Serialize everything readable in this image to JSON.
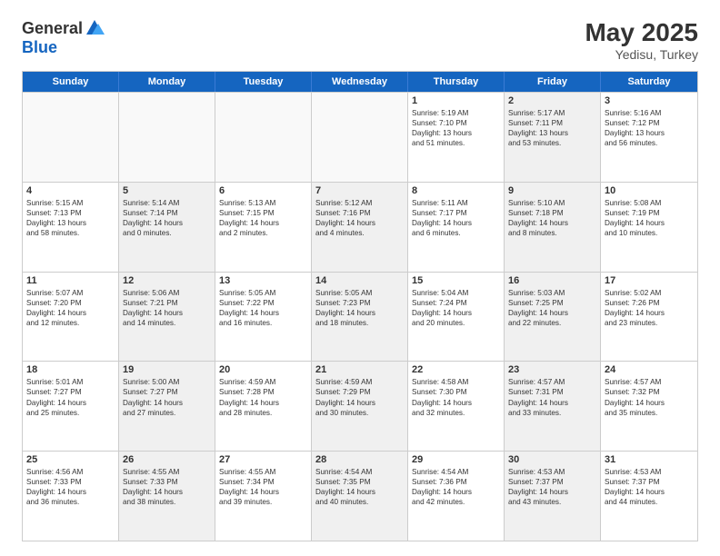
{
  "header": {
    "logo_general": "General",
    "logo_blue": "Blue",
    "month_year": "May 2025",
    "location": "Yedisu, Turkey"
  },
  "days_of_week": [
    "Sunday",
    "Monday",
    "Tuesday",
    "Wednesday",
    "Thursday",
    "Friday",
    "Saturday"
  ],
  "rows": [
    [
      {
        "day": "",
        "info": [],
        "empty": true
      },
      {
        "day": "",
        "info": [],
        "empty": true
      },
      {
        "day": "",
        "info": [],
        "empty": true
      },
      {
        "day": "",
        "info": [],
        "empty": true
      },
      {
        "day": "1",
        "info": [
          "Sunrise: 5:19 AM",
          "Sunset: 7:10 PM",
          "Daylight: 13 hours",
          "and 51 minutes."
        ]
      },
      {
        "day": "2",
        "info": [
          "Sunrise: 5:17 AM",
          "Sunset: 7:11 PM",
          "Daylight: 13 hours",
          "and 53 minutes."
        ],
        "shaded": true
      },
      {
        "day": "3",
        "info": [
          "Sunrise: 5:16 AM",
          "Sunset: 7:12 PM",
          "Daylight: 13 hours",
          "and 56 minutes."
        ]
      }
    ],
    [
      {
        "day": "4",
        "info": [
          "Sunrise: 5:15 AM",
          "Sunset: 7:13 PM",
          "Daylight: 13 hours",
          "and 58 minutes."
        ]
      },
      {
        "day": "5",
        "info": [
          "Sunrise: 5:14 AM",
          "Sunset: 7:14 PM",
          "Daylight: 14 hours",
          "and 0 minutes."
        ],
        "shaded": true
      },
      {
        "day": "6",
        "info": [
          "Sunrise: 5:13 AM",
          "Sunset: 7:15 PM",
          "Daylight: 14 hours",
          "and 2 minutes."
        ]
      },
      {
        "day": "7",
        "info": [
          "Sunrise: 5:12 AM",
          "Sunset: 7:16 PM",
          "Daylight: 14 hours",
          "and 4 minutes."
        ],
        "shaded": true
      },
      {
        "day": "8",
        "info": [
          "Sunrise: 5:11 AM",
          "Sunset: 7:17 PM",
          "Daylight: 14 hours",
          "and 6 minutes."
        ]
      },
      {
        "day": "9",
        "info": [
          "Sunrise: 5:10 AM",
          "Sunset: 7:18 PM",
          "Daylight: 14 hours",
          "and 8 minutes."
        ],
        "shaded": true
      },
      {
        "day": "10",
        "info": [
          "Sunrise: 5:08 AM",
          "Sunset: 7:19 PM",
          "Daylight: 14 hours",
          "and 10 minutes."
        ]
      }
    ],
    [
      {
        "day": "11",
        "info": [
          "Sunrise: 5:07 AM",
          "Sunset: 7:20 PM",
          "Daylight: 14 hours",
          "and 12 minutes."
        ]
      },
      {
        "day": "12",
        "info": [
          "Sunrise: 5:06 AM",
          "Sunset: 7:21 PM",
          "Daylight: 14 hours",
          "and 14 minutes."
        ],
        "shaded": true
      },
      {
        "day": "13",
        "info": [
          "Sunrise: 5:05 AM",
          "Sunset: 7:22 PM",
          "Daylight: 14 hours",
          "and 16 minutes."
        ]
      },
      {
        "day": "14",
        "info": [
          "Sunrise: 5:05 AM",
          "Sunset: 7:23 PM",
          "Daylight: 14 hours",
          "and 18 minutes."
        ],
        "shaded": true
      },
      {
        "day": "15",
        "info": [
          "Sunrise: 5:04 AM",
          "Sunset: 7:24 PM",
          "Daylight: 14 hours",
          "and 20 minutes."
        ]
      },
      {
        "day": "16",
        "info": [
          "Sunrise: 5:03 AM",
          "Sunset: 7:25 PM",
          "Daylight: 14 hours",
          "and 22 minutes."
        ],
        "shaded": true
      },
      {
        "day": "17",
        "info": [
          "Sunrise: 5:02 AM",
          "Sunset: 7:26 PM",
          "Daylight: 14 hours",
          "and 23 minutes."
        ]
      }
    ],
    [
      {
        "day": "18",
        "info": [
          "Sunrise: 5:01 AM",
          "Sunset: 7:27 PM",
          "Daylight: 14 hours",
          "and 25 minutes."
        ]
      },
      {
        "day": "19",
        "info": [
          "Sunrise: 5:00 AM",
          "Sunset: 7:27 PM",
          "Daylight: 14 hours",
          "and 27 minutes."
        ],
        "shaded": true
      },
      {
        "day": "20",
        "info": [
          "Sunrise: 4:59 AM",
          "Sunset: 7:28 PM",
          "Daylight: 14 hours",
          "and 28 minutes."
        ]
      },
      {
        "day": "21",
        "info": [
          "Sunrise: 4:59 AM",
          "Sunset: 7:29 PM",
          "Daylight: 14 hours",
          "and 30 minutes."
        ],
        "shaded": true
      },
      {
        "day": "22",
        "info": [
          "Sunrise: 4:58 AM",
          "Sunset: 7:30 PM",
          "Daylight: 14 hours",
          "and 32 minutes."
        ]
      },
      {
        "day": "23",
        "info": [
          "Sunrise: 4:57 AM",
          "Sunset: 7:31 PM",
          "Daylight: 14 hours",
          "and 33 minutes."
        ],
        "shaded": true
      },
      {
        "day": "24",
        "info": [
          "Sunrise: 4:57 AM",
          "Sunset: 7:32 PM",
          "Daylight: 14 hours",
          "and 35 minutes."
        ]
      }
    ],
    [
      {
        "day": "25",
        "info": [
          "Sunrise: 4:56 AM",
          "Sunset: 7:33 PM",
          "Daylight: 14 hours",
          "and 36 minutes."
        ]
      },
      {
        "day": "26",
        "info": [
          "Sunrise: 4:55 AM",
          "Sunset: 7:33 PM",
          "Daylight: 14 hours",
          "and 38 minutes."
        ],
        "shaded": true
      },
      {
        "day": "27",
        "info": [
          "Sunrise: 4:55 AM",
          "Sunset: 7:34 PM",
          "Daylight: 14 hours",
          "and 39 minutes."
        ]
      },
      {
        "day": "28",
        "info": [
          "Sunrise: 4:54 AM",
          "Sunset: 7:35 PM",
          "Daylight: 14 hours",
          "and 40 minutes."
        ],
        "shaded": true
      },
      {
        "day": "29",
        "info": [
          "Sunrise: 4:54 AM",
          "Sunset: 7:36 PM",
          "Daylight: 14 hours",
          "and 42 minutes."
        ]
      },
      {
        "day": "30",
        "info": [
          "Sunrise: 4:53 AM",
          "Sunset: 7:37 PM",
          "Daylight: 14 hours",
          "and 43 minutes."
        ],
        "shaded": true
      },
      {
        "day": "31",
        "info": [
          "Sunrise: 4:53 AM",
          "Sunset: 7:37 PM",
          "Daylight: 14 hours",
          "and 44 minutes."
        ]
      }
    ]
  ]
}
